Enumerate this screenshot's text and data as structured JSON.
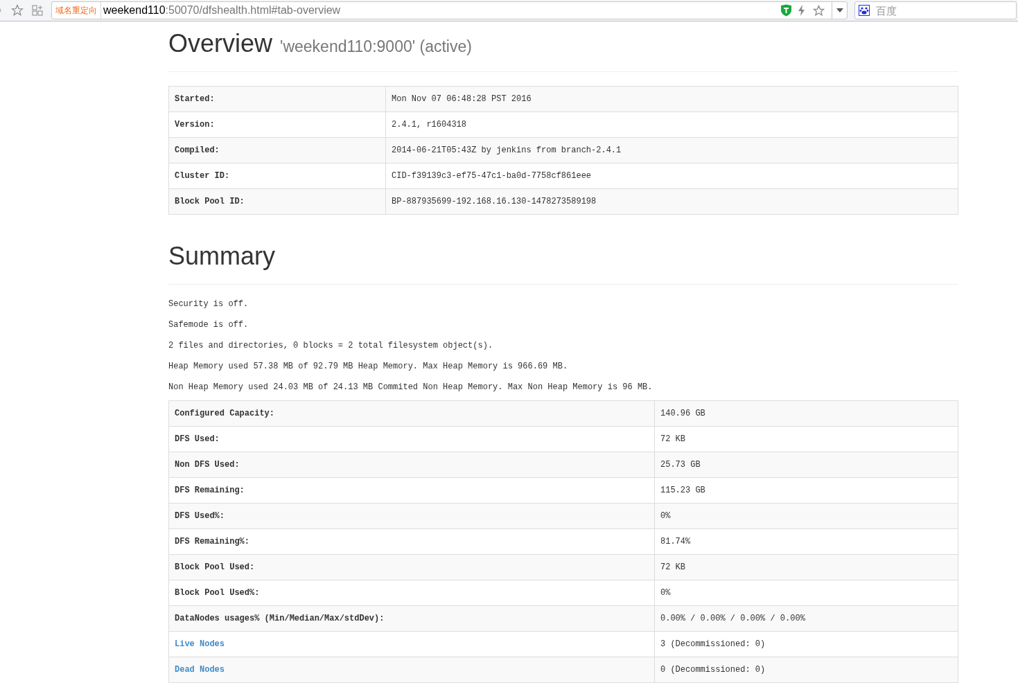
{
  "browser": {
    "badge": "域名重定向",
    "url_host": "weekend110",
    "url_rest": ":50070/dfshealth.html#tab-overview",
    "search": {
      "placeholder": "百度"
    }
  },
  "overview": {
    "title": "Overview",
    "subtitle": "'weekend110:9000' (active)",
    "rows": [
      {
        "label": "Started:",
        "value": "Mon Nov 07 06:48:28 PST 2016"
      },
      {
        "label": "Version:",
        "value": "2.4.1, r1604318"
      },
      {
        "label": "Compiled:",
        "value": "2014-06-21T05:43Z by jenkins from branch-2.4.1"
      },
      {
        "label": "Cluster ID:",
        "value": "CID-f39139c3-ef75-47c1-ba0d-7758cf861eee"
      },
      {
        "label": "Block Pool ID:",
        "value": "BP-887935699-192.168.16.130-1478273589198"
      }
    ]
  },
  "summary": {
    "title": "Summary",
    "lines": [
      "Security is off.",
      "Safemode is off.",
      "2 files and directories, 0 blocks = 2 total filesystem object(s).",
      "Heap Memory used 57.38 MB of 92.79 MB Heap Memory. Max Heap Memory is 966.69 MB.",
      "Non Heap Memory used 24.03 MB of 24.13 MB Commited Non Heap Memory. Max Non Heap Memory is 96 MB."
    ],
    "rows": [
      {
        "kind": "text",
        "label": "Configured Capacity:",
        "value": "140.96 GB"
      },
      {
        "kind": "text",
        "label": "DFS Used:",
        "value": "72 KB"
      },
      {
        "kind": "text",
        "label": "Non DFS Used:",
        "value": "25.73 GB"
      },
      {
        "kind": "text",
        "label": "DFS Remaining:",
        "value": "115.23 GB"
      },
      {
        "kind": "text",
        "label": "DFS Used%:",
        "value": "0%"
      },
      {
        "kind": "text",
        "label": "DFS Remaining%:",
        "value": "81.74%"
      },
      {
        "kind": "text",
        "label": "Block Pool Used:",
        "value": "72 KB"
      },
      {
        "kind": "text",
        "label": "Block Pool Used%:",
        "value": "0%"
      },
      {
        "kind": "text",
        "label": "DataNodes usages% (Min/Median/Max/stdDev):",
        "value": "0.00% / 0.00% / 0.00% / 0.00%"
      },
      {
        "kind": "link",
        "label": "Live Nodes",
        "value": "3 (Decommissioned: 0)"
      },
      {
        "kind": "link",
        "label": "Dead Nodes",
        "value": "0 (Decommissioned: 0)"
      }
    ]
  }
}
